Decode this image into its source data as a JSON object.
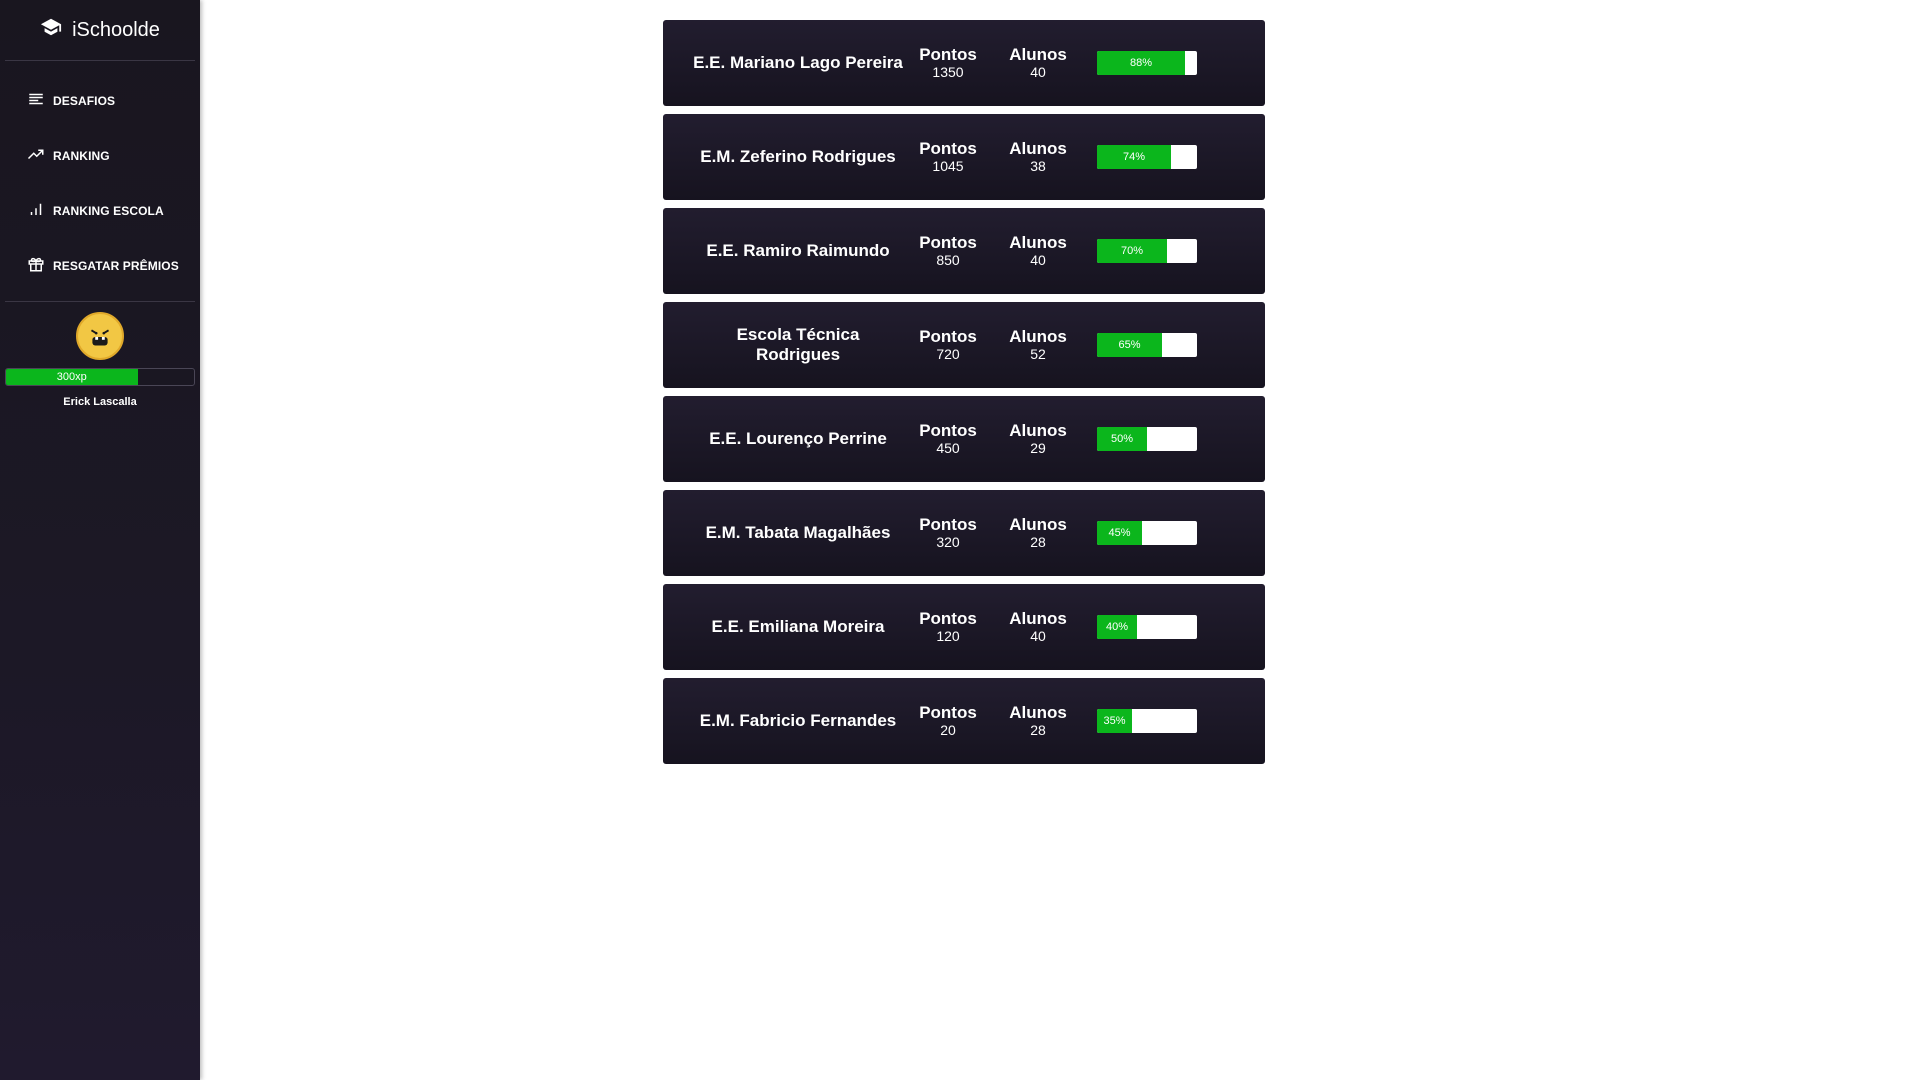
{
  "sidebar": {
    "brand": "iSchoolde",
    "items": [
      {
        "label": "DESAFIOS",
        "icon": "list-icon"
      },
      {
        "label": "RANKING",
        "icon": "trending-up-icon"
      },
      {
        "label": "RANKING ESCOLA",
        "icon": "bar-chart-icon"
      },
      {
        "label": "RESGATAR PRÊMIOS",
        "icon": "gift-icon"
      }
    ],
    "profile": {
      "xp_label": "300xp",
      "xp_fraction": 0.7,
      "name": "Erick Lascalla"
    }
  },
  "colors": {
    "sidebar_bg": "#1c1826",
    "card_bg": "#1c1826",
    "accent_green": "#0bb61c",
    "avatar_yellow": "#f2c744"
  },
  "ranking": [
    {
      "name": "E.E. Mariano Lago Pereira",
      "points_label": "Pontos",
      "points": "1350",
      "students_label": "Alunos",
      "students": "40",
      "progress": 88,
      "progress_label": "88%"
    },
    {
      "name": "E.M. Zeferino Rodrigues",
      "points_label": "Pontos",
      "points": "1045",
      "students_label": "Alunos",
      "students": "38",
      "progress": 74,
      "progress_label": "74%"
    },
    {
      "name": "E.E. Ramiro Raimundo",
      "points_label": "Pontos",
      "points": "850",
      "students_label": "Alunos",
      "students": "40",
      "progress": 70,
      "progress_label": "70%"
    },
    {
      "name": "Escola Técnica Rodrigues",
      "points_label": "Pontos",
      "points": "720",
      "students_label": "Alunos",
      "students": "52",
      "progress": 65,
      "progress_label": "65%"
    },
    {
      "name": "E.E. Lourenço Perrine",
      "points_label": "Pontos",
      "points": "450",
      "students_label": "Alunos",
      "students": "29",
      "progress": 50,
      "progress_label": "50%"
    },
    {
      "name": "E.M. Tabata Magalhães",
      "points_label": "Pontos",
      "points": "320",
      "students_label": "Alunos",
      "students": "28",
      "progress": 45,
      "progress_label": "45%"
    },
    {
      "name": "E.E. Emiliana Moreira",
      "points_label": "Pontos",
      "points": "120",
      "students_label": "Alunos",
      "students": "40",
      "progress": 40,
      "progress_label": "40%"
    },
    {
      "name": "E.M. Fabricio Fernandes",
      "points_label": "Pontos",
      "points": "20",
      "students_label": "Alunos",
      "students": "28",
      "progress": 35,
      "progress_label": "35%"
    }
  ]
}
